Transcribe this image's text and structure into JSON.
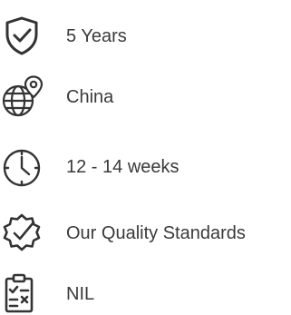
{
  "items": [
    {
      "icon": "shield-check-icon",
      "label": "5 Years"
    },
    {
      "icon": "globe-location-icon",
      "label": "China"
    },
    {
      "icon": "clock-icon",
      "label": "12 - 14 weeks"
    },
    {
      "icon": "quality-badge-check-icon",
      "label": "Our Quality Standards"
    },
    {
      "icon": "clipboard-checklist-icon",
      "label": "NIL"
    }
  ],
  "colors": {
    "icon_stroke": "#333333",
    "text": "#3a3a3a",
    "background": "#ffffff"
  }
}
